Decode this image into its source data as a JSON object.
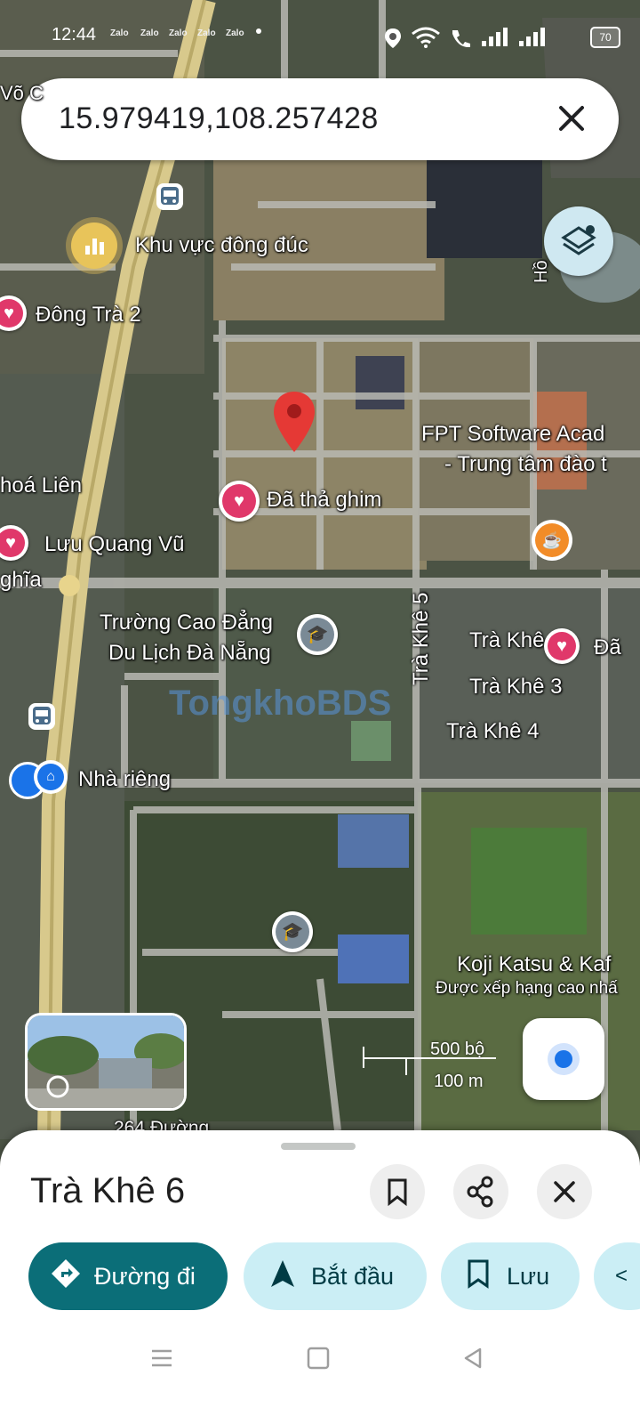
{
  "status_bar": {
    "time": "12:44",
    "notifications": [
      "Zalo",
      "Zalo",
      "Zalo",
      "Zalo",
      "Zalo"
    ],
    "battery": "70"
  },
  "search": {
    "query": "15.979419,108.257428"
  },
  "map_labels": {
    "crowded_area": "Khu vực đông đúc",
    "dong_tra_2": "Đông Trà 2",
    "pinned": "Đã thả ghim",
    "hoa_lien": "hoá Liên",
    "luu_quang_vu": "Lưu Quang Vũ",
    "nghia": "ghĩa",
    "college_line1": "Trường Cao Đẳng",
    "college_line2": "Du Lịch Đà Nẵng",
    "tra_khe_5": "Trà Khê 5",
    "tra_khe": "Trà Khê",
    "da": "Đã",
    "tra_khe_3": "Trà Khê 3",
    "tra_khe_4": "Trà Khê 4",
    "nha_rieng": "Nhà riêng",
    "fpt_line1": "FPT Software Acad",
    "fpt_line2": "- Trung tâm đào t",
    "koji": "Koji Katsu & Kaf",
    "koji_sub": "Được xếp hạng cao nhấ",
    "road_264": "264 Đường",
    "vo": "Võ C",
    "ho": "Hồ",
    "watermark": "TongkhoBDS"
  },
  "scale": {
    "imperial": "500 bộ",
    "metric": "100 m"
  },
  "place_sheet": {
    "title": "Trà Khê 6",
    "actions": {
      "directions": "Đường đi",
      "start": "Bắt đầu",
      "save": "Lưu"
    }
  },
  "colors": {
    "accent": "#0b6e78",
    "chip": "#cbeef5",
    "pin": "#e53935",
    "heart": "#e0386a"
  }
}
